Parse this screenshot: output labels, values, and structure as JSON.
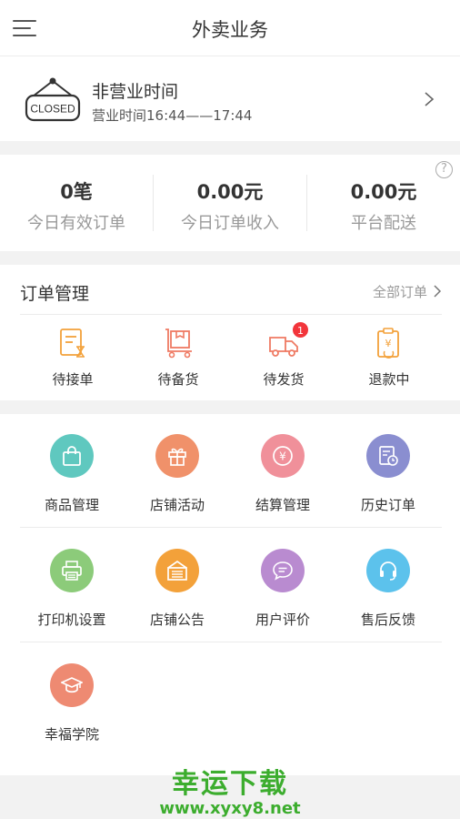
{
  "header": {
    "title": "外卖业务",
    "menu_icon": "menu-icon"
  },
  "status": {
    "sign_text": "CLOSED",
    "title": "非营业时间",
    "hours": "营业时间16:44——17:44"
  },
  "stats": {
    "help_glyph": "?",
    "items": [
      {
        "value": "0笔",
        "label": "今日有效订单"
      },
      {
        "value": "0.00元",
        "label": "今日订单收入"
      },
      {
        "value": "0.00元",
        "label": "平台配送"
      }
    ]
  },
  "orders": {
    "title": "订单管理",
    "all_label": "全部订单",
    "items": [
      {
        "label": "待接单",
        "icon": "pending-accept-icon"
      },
      {
        "label": "待备货",
        "icon": "pending-stock-icon"
      },
      {
        "label": "待发货",
        "icon": "delivery-truck-icon",
        "badge": "1"
      },
      {
        "label": "退款中",
        "icon": "refund-icon"
      }
    ]
  },
  "features": {
    "items": [
      {
        "label": "商品管理",
        "icon": "shopping-bag-icon",
        "color": "#5fc8bf"
      },
      {
        "label": "店铺活动",
        "icon": "gift-icon",
        "color": "#f0916a"
      },
      {
        "label": "结算管理",
        "icon": "yuan-coin-icon",
        "color": "#f0909a"
      },
      {
        "label": "历史订单",
        "icon": "history-order-icon",
        "color": "#8a8ed0"
      },
      {
        "label": "打印机设置",
        "icon": "printer-icon",
        "color": "#8ccb7a"
      },
      {
        "label": "店铺公告",
        "icon": "announcement-icon",
        "color": "#f3a13a"
      },
      {
        "label": "用户评价",
        "icon": "comment-icon",
        "color": "#b98bd0"
      },
      {
        "label": "售后反馈",
        "icon": "headset-icon",
        "color": "#5cc2ec"
      },
      {
        "label": "幸福学院",
        "icon": "graduation-cap-icon",
        "color": "#ee8a72"
      }
    ]
  },
  "watermark": {
    "title": "幸运下载",
    "url": "www.xyxy8.net",
    "color": "#3cad2e"
  }
}
